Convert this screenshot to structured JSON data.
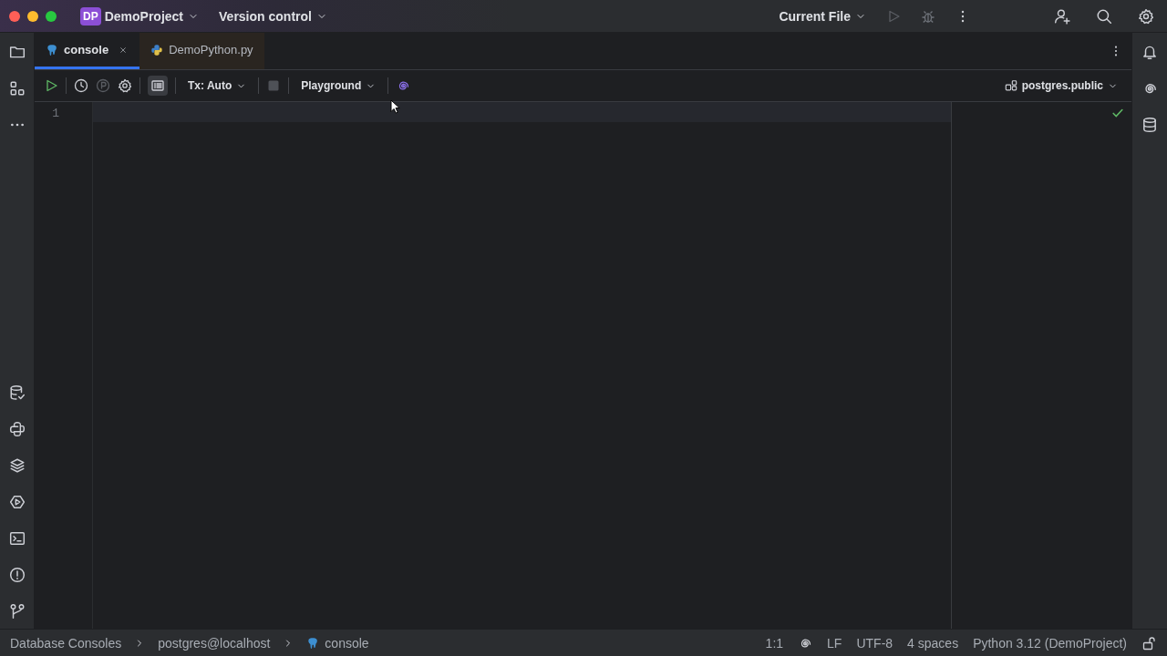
{
  "window": {
    "project_badge": "DP",
    "project": "DemoProject",
    "vcs": "Version control",
    "run_config": "Current File"
  },
  "tabs": [
    {
      "label": "console",
      "kind": "postgres",
      "selected": true,
      "closable": true
    },
    {
      "label": "DemoPython.py",
      "kind": "python",
      "selected": false,
      "closable": false
    }
  ],
  "toolbar": {
    "tx": "Tx: Auto",
    "schema_mode": "Playground",
    "schema": "postgres.public"
  },
  "editor": {
    "line_numbers": [
      "1"
    ],
    "inspection_ok": true
  },
  "status_bar": {
    "breadcrumbs": [
      {
        "label": "Database Consoles",
        "kind": "text"
      },
      {
        "label": "postgres@localhost",
        "kind": "text"
      },
      {
        "label": "console",
        "kind": "postgres"
      }
    ],
    "position": "1:1",
    "line_ending": "LF",
    "encoding": "UTF-8",
    "indent": "4 spaces",
    "interpreter": "Python 3.12 (DemoProject)"
  }
}
